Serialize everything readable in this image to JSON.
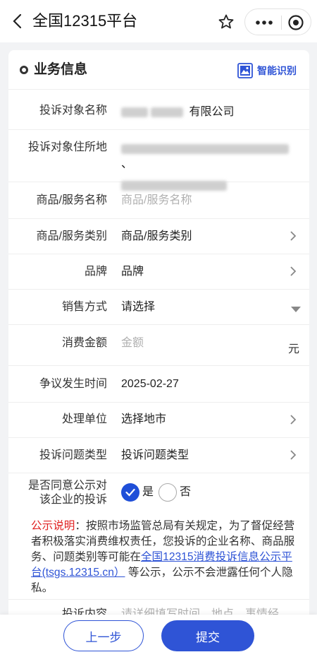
{
  "topbar": {
    "title": "全国12315平台",
    "back_icon": "chevron-left-icon",
    "star_icon": "star-icon",
    "more_icon": "more-dots-icon",
    "target_icon": "target-icon"
  },
  "section": {
    "title": "业务信息",
    "smart_label": "智能识别"
  },
  "form": {
    "target_name": {
      "label": "投诉对象名称",
      "value_suffix": "有限公司"
    },
    "target_address": {
      "label": "投诉对象住所地",
      "value_tail": "、"
    },
    "product_name": {
      "label": "商品/服务名称",
      "placeholder": "商品/服务名称"
    },
    "product_category": {
      "label": "商品/服务类别",
      "value": "商品/服务类别"
    },
    "brand": {
      "label": "品牌",
      "value": "品牌"
    },
    "sales_method": {
      "label": "销售方式",
      "value": "请选择"
    },
    "amount": {
      "label": "消费金额",
      "placeholder": "金额",
      "unit": "元"
    },
    "dispute_date": {
      "label": "争议发生时间",
      "value": "2025-02-27"
    },
    "handling_unit": {
      "label": "处理单位",
      "value": "选择地市"
    },
    "complaint_type": {
      "label": "投诉问题类型",
      "value": "投诉问题类型"
    },
    "publish_consent": {
      "label_line1": "是否同意公示对",
      "label_line2": "该企业的投诉",
      "yes": "是",
      "no": "否"
    },
    "content_label": "投诉内容",
    "content_placeholder": "请详细填写时间、地点、事情经"
  },
  "notice": {
    "prefix": "公示说明",
    "text1": "：按照市场监管总局有关规定，为了督促经营者积极落实消费维权责任，您投诉的企业名称、商品服务、问题类别等可能在",
    "link": "全国12315消费投诉信息公示平台(tsgs.12315.cn）",
    "text2": " 等公示，公示不会泄露任何个人隐私。"
  },
  "buttons": {
    "prev": "上一步",
    "submit": "提交"
  },
  "colors": {
    "accent": "#2f54d6",
    "notice_red": "#e02020"
  }
}
